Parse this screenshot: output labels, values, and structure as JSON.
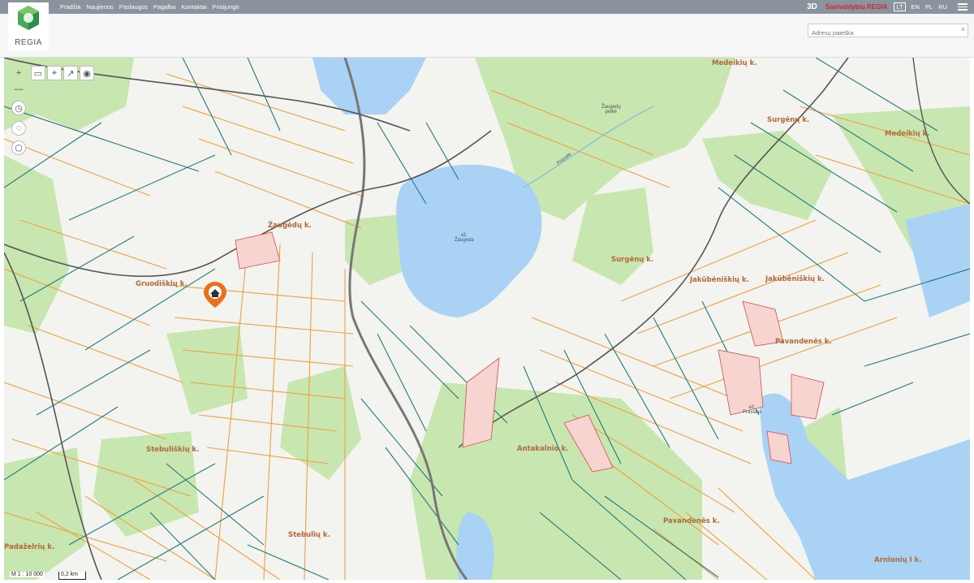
{
  "nav": [
    "Pradžia",
    "Naujienos",
    "Paslaugos",
    "Pagalba",
    "Kontaktai",
    "Prisijungti"
  ],
  "logo_text": "REGIA",
  "header": {
    "view_3d": "3D",
    "brand": "Savivaldybių REGIA",
    "langs": [
      "LT",
      "EN",
      "PL",
      "RU"
    ]
  },
  "search": {
    "placeholder": "Adresų paieška",
    "clear": "×"
  },
  "map": {
    "places": [
      {
        "id": "zaugedu",
        "name": "Žaugėdų k."
      },
      {
        "id": "gruodiskiu",
        "name": "Gruodiškių k."
      },
      {
        "id": "stebuliskiu",
        "name": "Stebuliškių k."
      },
      {
        "id": "stebuliu",
        "name": "Stebulių k."
      },
      {
        "id": "antakalnio",
        "name": "Antakalnio k."
      },
      {
        "id": "pavandenes1",
        "name": "Pavandenės k."
      },
      {
        "id": "pavandenes2",
        "name": "Pavandenės k."
      },
      {
        "id": "jakubeniskiu1",
        "name": "Jakūbėniškių k."
      },
      {
        "id": "jakubeniskiu2",
        "name": "Jakūbėniškių k."
      },
      {
        "id": "surgenu1",
        "name": "Surgėnų k."
      },
      {
        "id": "surgenu2",
        "name": "Surgėnų k."
      },
      {
        "id": "medeikiu1",
        "name": "Medeikių k."
      },
      {
        "id": "medeikiu2",
        "name": "Medeikių k."
      },
      {
        "id": "arnioniu",
        "name": "Arnionių I k."
      },
      {
        "id": "padazeriu",
        "name": "Padaželrių k."
      }
    ],
    "lake_zaugeda": "ež.\nŽaugeda",
    "lake_pravalas": "ež.\nPravalas",
    "river_pravala": "Pravala",
    "bog": "Žaugėdų\npelkė",
    "scale": "M 1 : 10 000",
    "scalebar": "0,2 km",
    "colors": {
      "water": "#a9d2f4",
      "forest": "#c8e6b0",
      "parcel_orange": "#f0a040",
      "parcel_teal": "#1f7a7a",
      "road": "#666666",
      "marker": "#e8721c"
    }
  }
}
